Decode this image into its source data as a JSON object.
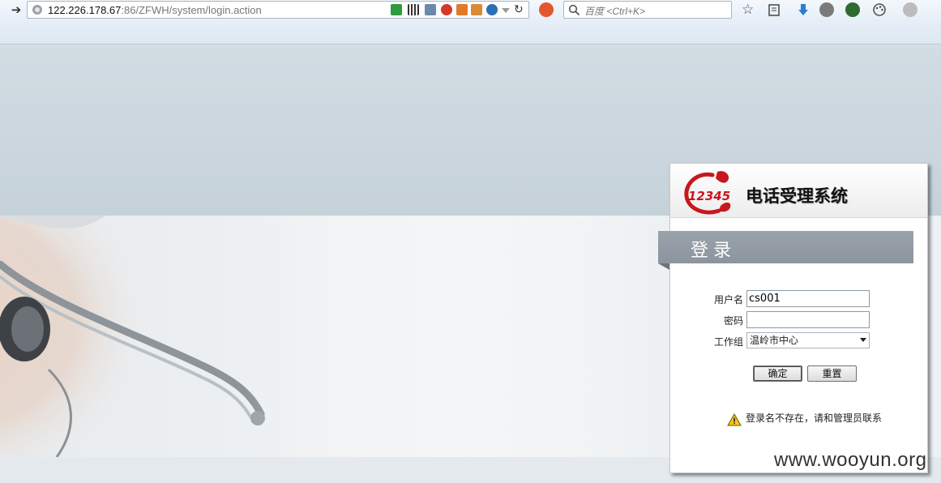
{
  "browser": {
    "url_host": "122.226.178.67",
    "url_rest": ":86/ZFWH/system/login.action",
    "search_placeholder": "百度 <Ctrl+K>"
  },
  "panel": {
    "logo_number": "12345",
    "system_title": "电话受理系统",
    "login_heading": "登录"
  },
  "form": {
    "username_label": "用户名",
    "username_value": "cs001",
    "password_label": "密码",
    "password_value": "",
    "workgroup_label": "工作组",
    "workgroup_selected": "温岭市中心",
    "confirm_label": "确定",
    "reset_label": "重置",
    "error_message": "登录名不存在，请和管理员联系"
  },
  "watermark": "www.wooyun.org",
  "colors": {
    "login_bar": "#8c959e",
    "logo_red": "#c8171d"
  },
  "icons": [
    "back-arrow-icon",
    "globe-icon",
    "shield-icon",
    "qr-icon",
    "translate-icon",
    "jb-icon",
    "java-icon",
    "refresh-icon",
    "search-icon",
    "star-icon",
    "bookmarks-icon",
    "download-icon",
    "smiley-icon",
    "palette-icon",
    "warning-icon"
  ]
}
